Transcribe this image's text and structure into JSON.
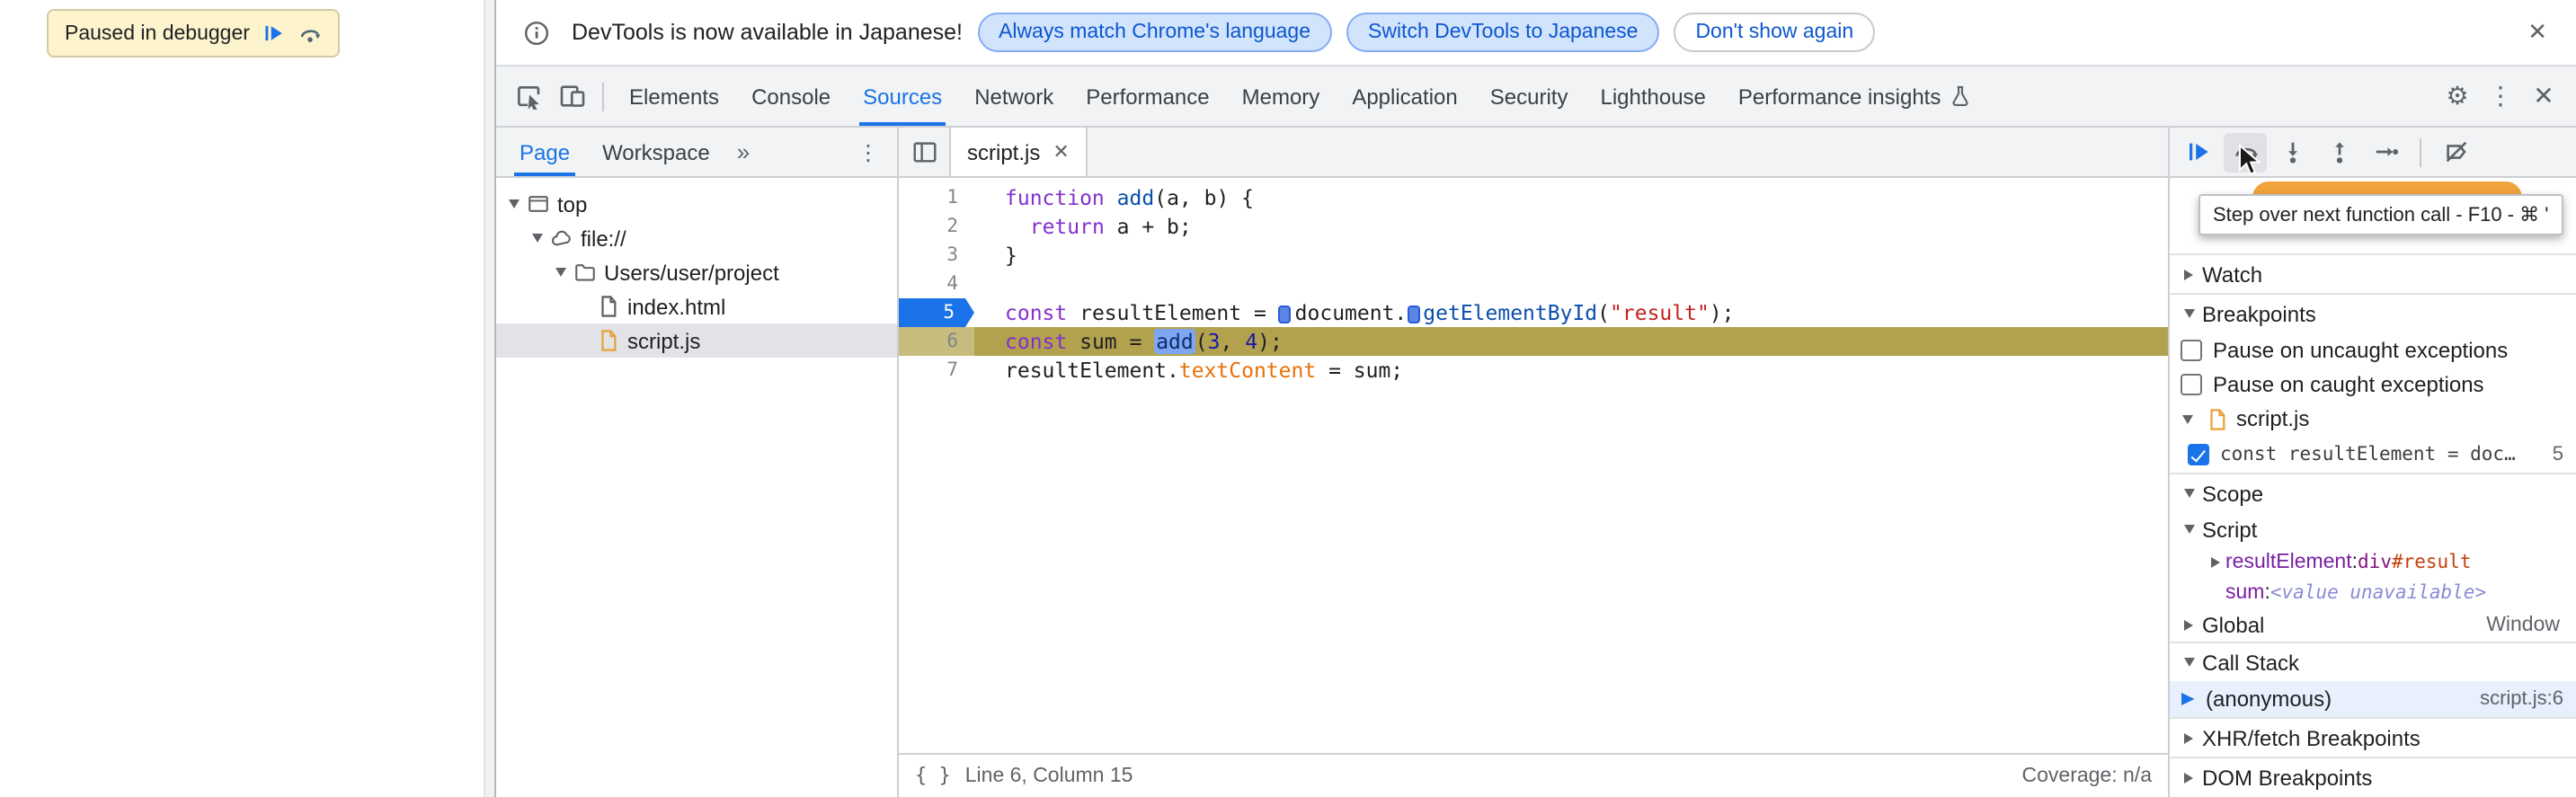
{
  "page": {
    "paused_overlay": {
      "label": "Paused in debugger"
    }
  },
  "banner": {
    "message": "DevTools is now available in Japanese!",
    "actions": [
      "Always match Chrome's language",
      "Switch DevTools to Japanese",
      "Don't show again"
    ]
  },
  "toolbar": {
    "tabs": [
      "Elements",
      "Console",
      "Sources",
      "Network",
      "Performance",
      "Memory",
      "Application",
      "Security",
      "Lighthouse",
      "Performance insights"
    ],
    "selected_tab": "Sources"
  },
  "icons": {
    "gear": "⚙",
    "kebab": "⋮",
    "close": "✕",
    "braces": "{ }"
  },
  "navigator": {
    "tabs": [
      "Page",
      "Workspace"
    ],
    "selected_tab": "Page",
    "more_tabs": "»",
    "tree": [
      {
        "label": "top",
        "icon": "frame-icon",
        "depth": 0,
        "expanded": true
      },
      {
        "label": "file://",
        "icon": "cloud-icon",
        "depth": 1,
        "expanded": true
      },
      {
        "label": "Users/user/project",
        "icon": "folder-icon",
        "depth": 2,
        "expanded": true
      },
      {
        "label": "index.html",
        "icon": "html-file-icon",
        "depth": 3
      },
      {
        "label": "script.js",
        "icon": "js-file-icon",
        "depth": 3,
        "selected": true
      }
    ]
  },
  "editor": {
    "tab_title": "script.js",
    "lines": [
      {
        "num": "1",
        "tokens": [
          [
            "kw",
            "function"
          ],
          [
            "pl",
            " "
          ],
          [
            "fn",
            "add"
          ],
          [
            "pl",
            "(a, b) {"
          ]
        ]
      },
      {
        "num": "2",
        "tokens": [
          [
            "pl",
            "  "
          ],
          [
            "kw",
            "return"
          ],
          [
            "pl",
            " a + b;"
          ]
        ]
      },
      {
        "num": "3",
        "tokens": [
          [
            "pl",
            "}"
          ]
        ]
      },
      {
        "num": "4",
        "tokens": []
      },
      {
        "num": "5",
        "breakpoint": true,
        "tokens": [
          [
            "kw",
            "const"
          ],
          [
            "pl",
            " resultElement = "
          ],
          [
            "marker",
            ""
          ],
          [
            "pl",
            "document."
          ],
          [
            "marker",
            ""
          ],
          [
            "fn",
            "getElementById"
          ],
          [
            "pl",
            "("
          ],
          [
            "str",
            "\"result\""
          ],
          [
            "pl",
            ");"
          ]
        ]
      },
      {
        "num": "6",
        "current": true,
        "tokens": [
          [
            "kw",
            "const"
          ],
          [
            "pl",
            " sum = "
          ],
          [
            "sel",
            "add"
          ],
          [
            "pl",
            "("
          ],
          [
            "num",
            "3"
          ],
          [
            "pl",
            ", "
          ],
          [
            "num",
            "4"
          ],
          [
            "pl",
            ");"
          ]
        ]
      },
      {
        "num": "7",
        "tokens": [
          [
            "pl",
            "resultElement."
          ],
          [
            "prop",
            "textContent"
          ],
          [
            "pl",
            " = sum;"
          ]
        ]
      }
    ],
    "status": {
      "position": "Line 6, Column 15",
      "coverage": "Coverage: n/a"
    }
  },
  "debugger": {
    "tooltip": "Step over next function call - F10 - ⌘ '",
    "sections": {
      "watch": "Watch",
      "breakpoints": "Breakpoints",
      "scope": "Scope",
      "call_stack": "Call Stack",
      "xhr": "XHR/fetch Breakpoints",
      "dom": "DOM Breakpoints"
    },
    "breakpoints": {
      "toggles": [
        {
          "label": "Pause on uncaught exceptions",
          "checked": false
        },
        {
          "label": "Pause on caught exceptions",
          "checked": false
        }
      ],
      "file": "script.js",
      "entries": [
        {
          "checked": true,
          "code": "const resultElement = doc…",
          "line": "5"
        }
      ]
    },
    "scope": {
      "separator": ": ",
      "script_group": "Script",
      "vars": [
        {
          "name": "resultElement",
          "expandable": true,
          "value_parts": [
            [
              "tag",
              "div"
            ],
            [
              "id",
              "#result"
            ]
          ]
        },
        {
          "name": "sum",
          "expandable": false,
          "value_parts": [
            [
              "unavail",
              "<value unavailable>"
            ]
          ]
        }
      ],
      "global_group": "Global",
      "global_note": "Window"
    },
    "call_stack": {
      "frames": [
        {
          "name": "(anonymous)",
          "location": "script.js:6",
          "current": true
        }
      ]
    }
  },
  "colors": {
    "accent": "#1a73e8",
    "paused_line": "#b2a14d",
    "breakpoint_blue": "#1a73e8",
    "paused_toast_orange": "#f1a33c"
  }
}
